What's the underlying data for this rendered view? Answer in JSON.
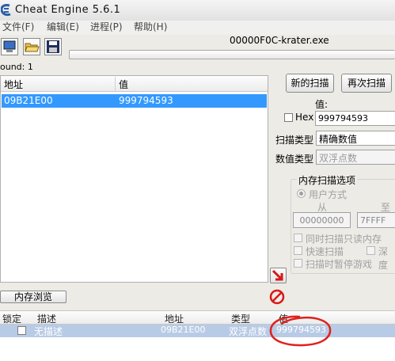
{
  "window": {
    "title": "Cheat Engine 5.6.1",
    "process": "00000F0C-krater.exe"
  },
  "menu": [
    "文件(F)",
    "编辑(E)",
    "进程(P)",
    "帮助(H)"
  ],
  "found": "ound: 1",
  "address_list": {
    "columns": [
      "地址",
      "值"
    ],
    "rows": [
      {
        "address": "09B21E00",
        "value": "999794593"
      }
    ]
  },
  "scan": {
    "new_scan": "新的扫描",
    "next_scan": "再次扫描",
    "value_label": "值:",
    "hex_label": "Hex",
    "value_input": "999794593",
    "scan_type_label": "扫描类型",
    "scan_type_value": "精确数值",
    "value_type_label": "数值类型",
    "value_type_value": "双浮点数"
  },
  "memory_options": {
    "title": "内存扫描选项",
    "user_mode": "用户方式",
    "from_label": "从",
    "to_label": "至",
    "from_value": "00000000",
    "to_value": "7FFFF",
    "readonly": "同时扫描只读内存",
    "fast_scan": "快速扫描",
    "deep": "深度",
    "pause_game": "扫描时暂停游戏"
  },
  "memory_view_button": "内存浏览",
  "cheat_table": {
    "columns": [
      "锁定",
      "描述",
      "地址",
      "类型",
      "值"
    ],
    "rows": [
      {
        "description": "无描述",
        "address": "09B21E00",
        "type": "双浮点数",
        "value": "999794593"
      }
    ]
  }
}
